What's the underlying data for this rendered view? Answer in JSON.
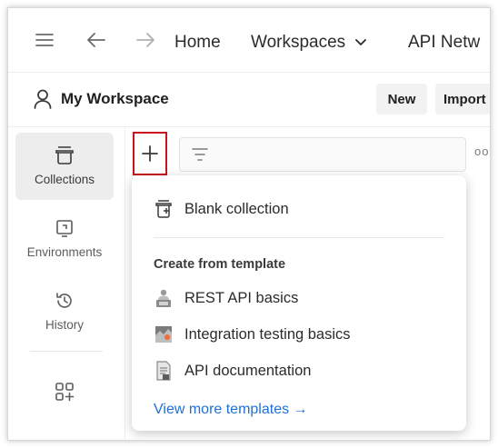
{
  "topbar": {
    "home": "Home",
    "workspaces": "Workspaces",
    "api_network": "API Netw"
  },
  "workspace": {
    "title": "My Workspace",
    "new_label": "New",
    "import_label": "Import"
  },
  "sidebar": {
    "items": [
      {
        "label": "Collections",
        "icon": "collections-icon"
      },
      {
        "label": "Environments",
        "icon": "environments-icon"
      },
      {
        "label": "History",
        "icon": "history-icon"
      },
      {
        "label": "",
        "icon": "apps-grid-icon"
      }
    ]
  },
  "toolbar": {
    "more": "oo"
  },
  "menu": {
    "blank": "Blank collection",
    "section_title": "Create from template",
    "templates": [
      {
        "label": "REST API basics",
        "icon": "rest-api-icon"
      },
      {
        "label": "Integration testing basics",
        "icon": "integration-icon"
      },
      {
        "label": "API documentation",
        "icon": "documentation-icon"
      }
    ],
    "view_more": "View more templates →"
  },
  "colors": {
    "highlight": "#c8141c",
    "link": "#1f6fd6",
    "accent_orange": "#f26b3a"
  }
}
